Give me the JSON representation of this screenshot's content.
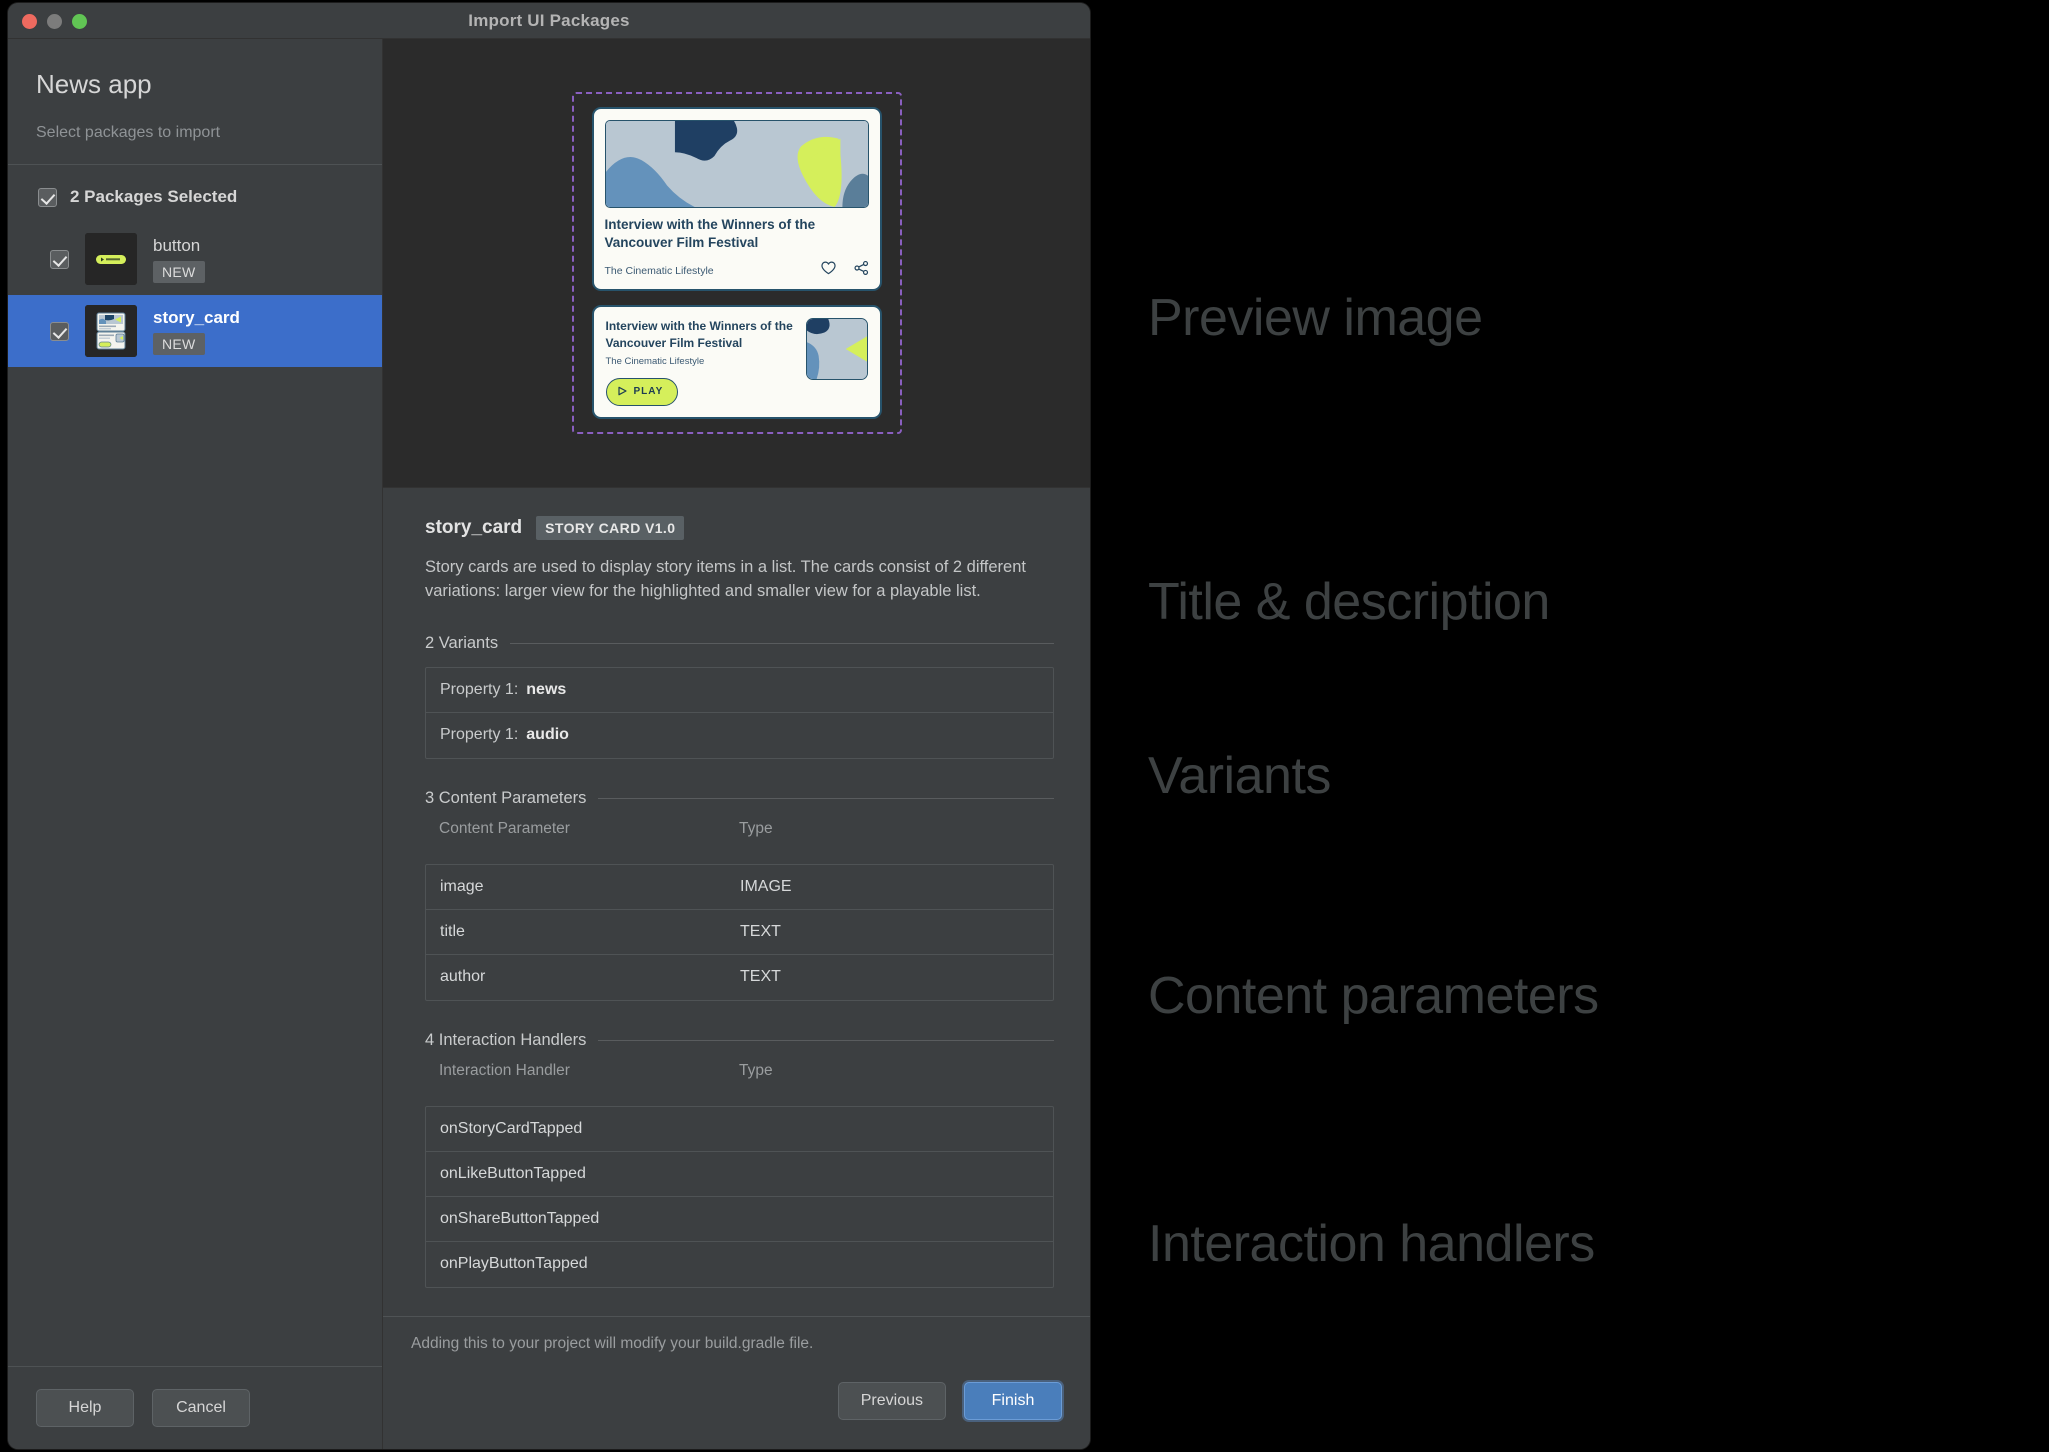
{
  "window": {
    "title": "Import UI Packages",
    "traffic_lights": [
      "close",
      "minimize",
      "zoom"
    ]
  },
  "sidebar": {
    "app_title": "News app",
    "subtitle": "Select packages to import",
    "select_all_label": "2 Packages Selected",
    "packages": [
      {
        "name": "button",
        "badge": "NEW",
        "checked": true,
        "selected": false,
        "thumb": "button-thumbnail"
      },
      {
        "name": "story_card",
        "badge": "NEW",
        "checked": true,
        "selected": true,
        "thumb": "story-card-thumbnail"
      }
    ],
    "footer_buttons": [
      {
        "label": "Help",
        "name": "help-button"
      },
      {
        "label": "Cancel",
        "name": "cancel-button"
      }
    ]
  },
  "preview": {
    "card_large": {
      "title": "Interview with the Winners of the Vancouver Film Festival",
      "author": "The Cinematic Lifestyle",
      "icons": [
        "heart-icon",
        "share-icon"
      ]
    },
    "card_small": {
      "title": "Interview with the Winners of the Vancouver Film Festival",
      "author": "The Cinematic Lifestyle",
      "play_label": "PLAY"
    }
  },
  "detail": {
    "component_name": "story_card",
    "version_badge": "STORY CARD V1.0",
    "description": "Story cards are used to display story items in a list. The cards consist of 2 different variations: larger view for the highlighted and smaller view for a playable list.",
    "variants": {
      "heading": "2 Variants",
      "rows": [
        {
          "label": "Property 1:",
          "value": "news"
        },
        {
          "label": "Property 1:",
          "value": "audio"
        }
      ]
    },
    "content_parameters": {
      "heading": "3 Content Parameters",
      "columns": [
        "Content Parameter",
        "Type"
      ],
      "rows": [
        {
          "name": "image",
          "type": "IMAGE"
        },
        {
          "name": "title",
          "type": "TEXT"
        },
        {
          "name": "author",
          "type": "TEXT"
        }
      ]
    },
    "interaction_handlers": {
      "heading": "4 Interaction Handlers",
      "columns": [
        "Interaction Handler",
        "Type"
      ],
      "rows": [
        {
          "name": "onStoryCardTapped",
          "type": ""
        },
        {
          "name": "onLikeButtonTapped",
          "type": ""
        },
        {
          "name": "onShareButtonTapped",
          "type": ""
        },
        {
          "name": "onPlayButtonTapped",
          "type": ""
        }
      ]
    },
    "footer_note": "Adding this to your project will modify your build.gradle file.",
    "footer_buttons": [
      {
        "label": "Previous",
        "name": "previous-button",
        "primary": false
      },
      {
        "label": "Finish",
        "name": "finish-button",
        "primary": true
      }
    ]
  },
  "annotations": [
    {
      "text": "Preview image",
      "name": "annotation-preview-image"
    },
    {
      "text": "Title & description",
      "name": "annotation-title-description"
    },
    {
      "text": "Variants",
      "name": "annotation-variants"
    },
    {
      "text": "Content parameters",
      "name": "annotation-content-parameters"
    },
    {
      "text": "Interaction handlers",
      "name": "annotation-interaction-handlers"
    }
  ],
  "colors": {
    "window_bg": "#3c3f41",
    "preview_bg": "#2b2b2b",
    "selection_blue": "#3c6eca",
    "primary_button": "#4a7ebb",
    "dashed_outline": "#8a5fc0",
    "card_accent_green": "#d5ef5b",
    "card_ink": "#24455e",
    "annotation_grey": "#3d4142"
  }
}
